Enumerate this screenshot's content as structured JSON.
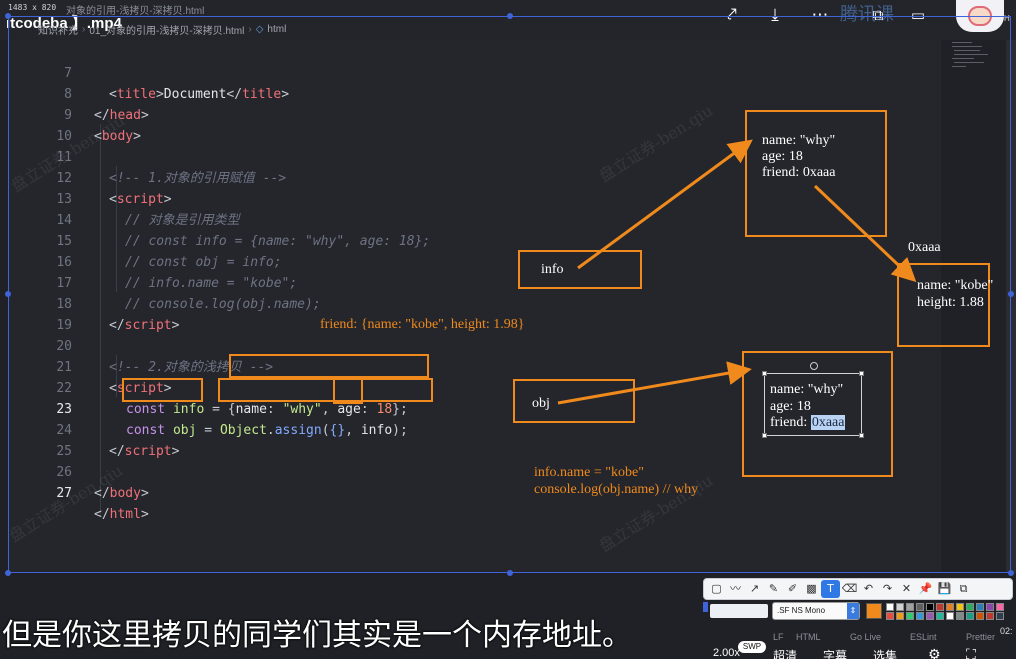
{
  "window": {
    "size_label": "1483 x 820",
    "file_title": "itcodeba 】.mp4",
    "tab_name": "对象的引用-浅拷贝-深拷贝.html",
    "breadcrumbs": [
      "知识补充",
      "01_对象的引用-浅拷贝-深拷贝.html",
      "html"
    ]
  },
  "top_icons": [
    "share-icon",
    "download-icon",
    "more-icon",
    "cast-icon",
    "minimize-icon"
  ],
  "brand_text": "腾讯课",
  "corner_label": "H",
  "code_lines": [
    {
      "n": "7"
    },
    {
      "n": "8"
    },
    {
      "n": "9"
    },
    {
      "n": "10"
    },
    {
      "n": "11"
    },
    {
      "n": "12"
    },
    {
      "n": "13"
    },
    {
      "n": "14"
    },
    {
      "n": "15"
    },
    {
      "n": "16"
    },
    {
      "n": "17"
    },
    {
      "n": "18"
    },
    {
      "n": "19"
    },
    {
      "n": "20"
    },
    {
      "n": "21"
    },
    {
      "n": "22"
    },
    {
      "n": "23"
    },
    {
      "n": "24"
    },
    {
      "n": "25"
    },
    {
      "n": "26"
    },
    {
      "n": "27"
    }
  ],
  "code": {
    "l7": [
      "<",
      "title",
      ">",
      "Document",
      "</",
      "title",
      ">"
    ],
    "l8": [
      "</",
      "head",
      ">"
    ],
    "l9": [
      "<",
      "body",
      ">"
    ],
    "l11": "<!-- 1.对象的引用赋值 -->",
    "l12": [
      "<",
      "script",
      ">"
    ],
    "l13": "// 对象是引用类型",
    "l14": "// const info = {name: \"why\", age: 18};",
    "l15": "// const obj = info;",
    "l16": "// info.name = \"kobe\";",
    "l17": "// console.log(obj.name);",
    "l18": [
      "</",
      "script",
      ">"
    ],
    "l20": "<!-- 2.对象的浅拷贝 -->",
    "l21": [
      "<",
      "script",
      ">"
    ],
    "l22": {
      "kw": "const",
      "var": "info",
      "eq": "=",
      "open": "{",
      "k1": "name",
      "colon": ":",
      "v1": "\"why\"",
      "comma": ",",
      "k2": "age",
      "v2": "18",
      "close": "};"
    },
    "l23": {
      "kw": "const",
      "var": "obj",
      "eq": "=",
      "cls": "Object",
      "dot": ".",
      "fn": "assign",
      "po": "(",
      "arg1": "{}",
      "comma": ",",
      "arg2": "info",
      "pc": ");"
    },
    "l24": [
      "</",
      "script",
      ">"
    ],
    "l26": [
      "</",
      "body",
      ">"
    ],
    "l27": [
      "</",
      "html",
      ">"
    ]
  },
  "annotations": {
    "friend_note": "friend: {name: \"kobe\", height: 1.98}",
    "info_label": "info",
    "obj_label": "obj",
    "addr_label": "0xaaa",
    "box1": {
      "l1": "name: \"why\"",
      "l2": "age: 18",
      "l3": "friend: 0xaaa"
    },
    "box2": {
      "l1": "name: \"kobe\"",
      "l2": "height: 1.88"
    },
    "box3": {
      "l1": "name: \"why\"",
      "l2": "age: 18",
      "l3": "friend: ",
      "l3b": "0xaaa"
    },
    "bottom_note_1": "info.name = \"kobe\"",
    "bottom_note_2": "console.log(obj.name) // why"
  },
  "watermark": "盘立证券-ben.qiu",
  "draw_toolbar": {
    "tools": [
      "rectangle-tool",
      "pencil-tool",
      "arrow-tool",
      "pen-tool",
      "highlighter-tool",
      "mosaic-tool",
      "text-tool",
      "eraser-tool",
      "undo-tool",
      "redo-tool",
      "close-tool",
      "pin-tool",
      "save-tool",
      "copy-tool"
    ],
    "tool_glyphs": [
      "▢",
      "〰",
      "↗",
      "✎",
      "✐",
      "▩",
      "T",
      "⌫",
      "↶",
      "↷",
      "✕",
      "📌",
      "💾",
      "⧉"
    ],
    "active_tool": 6,
    "font_name": ".SF NS Mono",
    "current_color": "#f08a1c",
    "palette": [
      "#ffffff",
      "#d0d0d0",
      "#a0a0a0",
      "#606060",
      "#000000",
      "#c0392b",
      "#e67e22",
      "#f1c40f",
      "#27ae60",
      "#2980b9",
      "#8e44ad",
      "#ff66aa",
      "#e74c3c",
      "#f39c12",
      "#2ecc71",
      "#3498db",
      "#9b59b6",
      "#1abc9c",
      "#ffffff",
      "#7f8c8d",
      "#16a085",
      "#d35400",
      "#c0392b",
      "#2c3e50"
    ]
  },
  "subtitle": "但是你这里拷贝的同学们其实是一个内存地址。",
  "status": {
    "items": [
      "LF",
      "HTML",
      "Go Live",
      "ESLint",
      "Prettier"
    ],
    "speed": "2.00x",
    "swp": "SWP",
    "controls": [
      "超清",
      "字幕",
      "选集"
    ],
    "time": "02:"
  }
}
